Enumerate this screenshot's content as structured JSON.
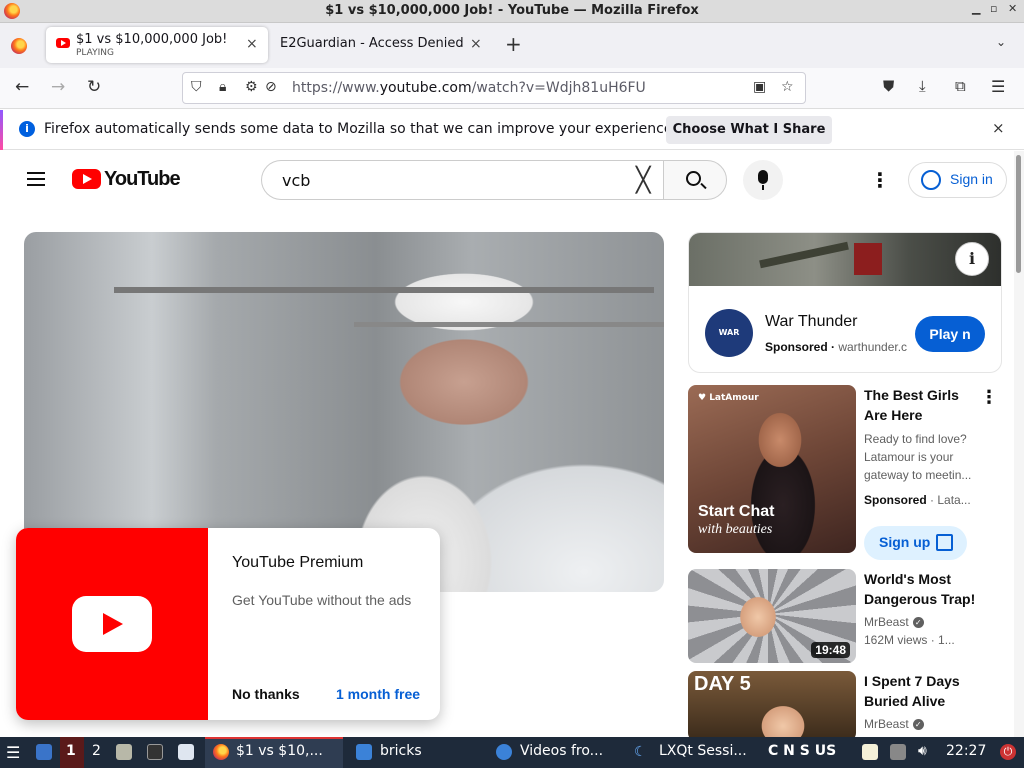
{
  "window": {
    "title": "$1 vs $10,000,000 Job! - YouTube — Mozilla Firefox"
  },
  "tabs": [
    {
      "title": "$1 vs $10,000,000 Job!",
      "status": "PLAYING",
      "close": "×"
    },
    {
      "title": "E2Guardian - Access Denied",
      "close": "×"
    }
  ],
  "toolbar": {
    "new_tab": "+",
    "tab_list": "⌄",
    "back": "←",
    "forward": "→",
    "reload": "↻"
  },
  "urlbar": {
    "prefix": "https://www.",
    "domain": "youtube.com",
    "path": "/watch?v=Wdjh81uH6FU"
  },
  "notification": {
    "message": "Firefox automatically sends some data to Mozilla so that we can improve your experience.",
    "button": "Choose What I Share",
    "close": "×"
  },
  "youtube": {
    "logo_text": "YouTube",
    "search_query": "vcb",
    "search_clear": "╳",
    "kebab": "⋮",
    "sign_in": "Sign in"
  },
  "premium_popup": {
    "title": "YouTube Premium",
    "subtitle": "Get YouTube without the ads",
    "decline": "No thanks",
    "accept": "1 month free"
  },
  "sidebar": {
    "ad1": {
      "logo_text": "WAR THUNDER",
      "info": "i",
      "name": "War Thunder",
      "sponsored": "Sponsored",
      "domain": "warthunder.c",
      "cta": "Play n"
    },
    "ad2": {
      "brand": "♥ LatAmour",
      "thumb_line1": "Start Chat",
      "thumb_line2": "with beauties",
      "title": "The Best Girls Are Here",
      "desc": "Ready to find love? Latamour is your gateway to meetin...",
      "sponsored": "Sponsored",
      "advertiser": "Lata...",
      "kebab": "⋮",
      "cta": "Sign up"
    },
    "videos": [
      {
        "title": "World's Most Dangerous Trap!",
        "channel": "MrBeast",
        "meta": "162M views · 1...",
        "duration": "19:48"
      },
      {
        "title": "I Spent 7 Days Buried Alive",
        "channel": "MrBeast",
        "thumb_text": "DAY 5"
      }
    ]
  },
  "taskbar": {
    "workspace1": "1",
    "workspace2": "2",
    "firefox": "$1 vs $10,...",
    "files": "bricks",
    "videos": "Videos fro...",
    "lxqt": "LXQt Sessi...",
    "keyboard": "C N S US",
    "clock": "22:27"
  },
  "colors": {
    "yt_red": "#ff0000",
    "yt_blue": "#065fd4",
    "taskbar": "#1e2a3a"
  }
}
